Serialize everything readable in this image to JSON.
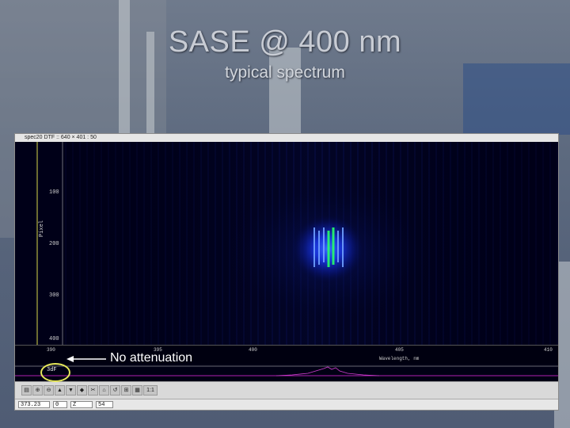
{
  "header": {
    "title": "SASE @ 400 nm",
    "subtitle": "typical spectrum"
  },
  "window": {
    "title_bar": "spec20 DTF :: 640 × 401 : 50",
    "y_ticks": [
      "100",
      "200",
      "300",
      "400"
    ],
    "y_axis_label": "Pixel",
    "x_ticks": [
      "390",
      "395",
      "400",
      "405",
      "410"
    ],
    "x_axis_label": "Wavelength, nm",
    "side_label": "3dF",
    "toolbar_buttons": [
      "▤",
      "⊕",
      "⊖",
      "▲",
      "▼",
      "◆",
      "✂",
      "⌂",
      "↺",
      "⊞",
      "▦",
      "1:1"
    ],
    "status": {
      "field_a": "373.23",
      "field_b": "0",
      "field_c": "Z",
      "field_d": "54"
    }
  },
  "annotation": {
    "text": "No attenuation",
    "arrow_color": "#ffffff",
    "circle_color": "#e7e85a"
  },
  "colors": {
    "spectrum_core": "#27ff6a",
    "spectrum_glow": "#1c3cff",
    "plot_bg": "#000018"
  }
}
